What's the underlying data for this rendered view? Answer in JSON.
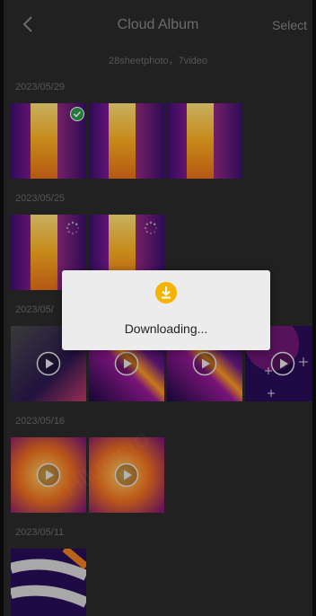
{
  "header": {
    "title": "Cloud Album",
    "select_label": "Select",
    "back_icon": "chevron-left-icon"
  },
  "summary": "28sheetphoto，7video",
  "groups": [
    {
      "date": "2023/05/29",
      "items": [
        {
          "type": "photo",
          "variant": "bar",
          "badge": "downloaded"
        },
        {
          "type": "photo",
          "variant": "bar"
        },
        {
          "type": "photo",
          "variant": "bar"
        }
      ]
    },
    {
      "date": "2023/05/25",
      "items": [
        {
          "type": "photo",
          "variant": "bar",
          "badge": "loading"
        },
        {
          "type": "photo",
          "variant": "bar",
          "badge": "loading"
        }
      ]
    },
    {
      "date": "2023/05/",
      "items": [
        {
          "type": "video",
          "variant": "noise"
        },
        {
          "type": "video",
          "variant": "streak"
        },
        {
          "type": "video",
          "variant": "streak"
        },
        {
          "type": "video",
          "variant": "crosshair"
        }
      ]
    },
    {
      "date": "2023/05/16",
      "items": [
        {
          "type": "video",
          "variant": "hot"
        },
        {
          "type": "video",
          "variant": "hot"
        }
      ]
    },
    {
      "date": "2023/05/11",
      "items": [
        {
          "type": "photo",
          "variant": "pipes"
        }
      ]
    }
  ],
  "dialog": {
    "text": "Downloading...",
    "icon": "download-icon",
    "icon_color": "#f5b400"
  },
  "colors": {
    "background": "#2b2b2b",
    "text_muted": "#8a8a8a",
    "dialog_bg": "#ececec",
    "accent": "#f5b400"
  }
}
